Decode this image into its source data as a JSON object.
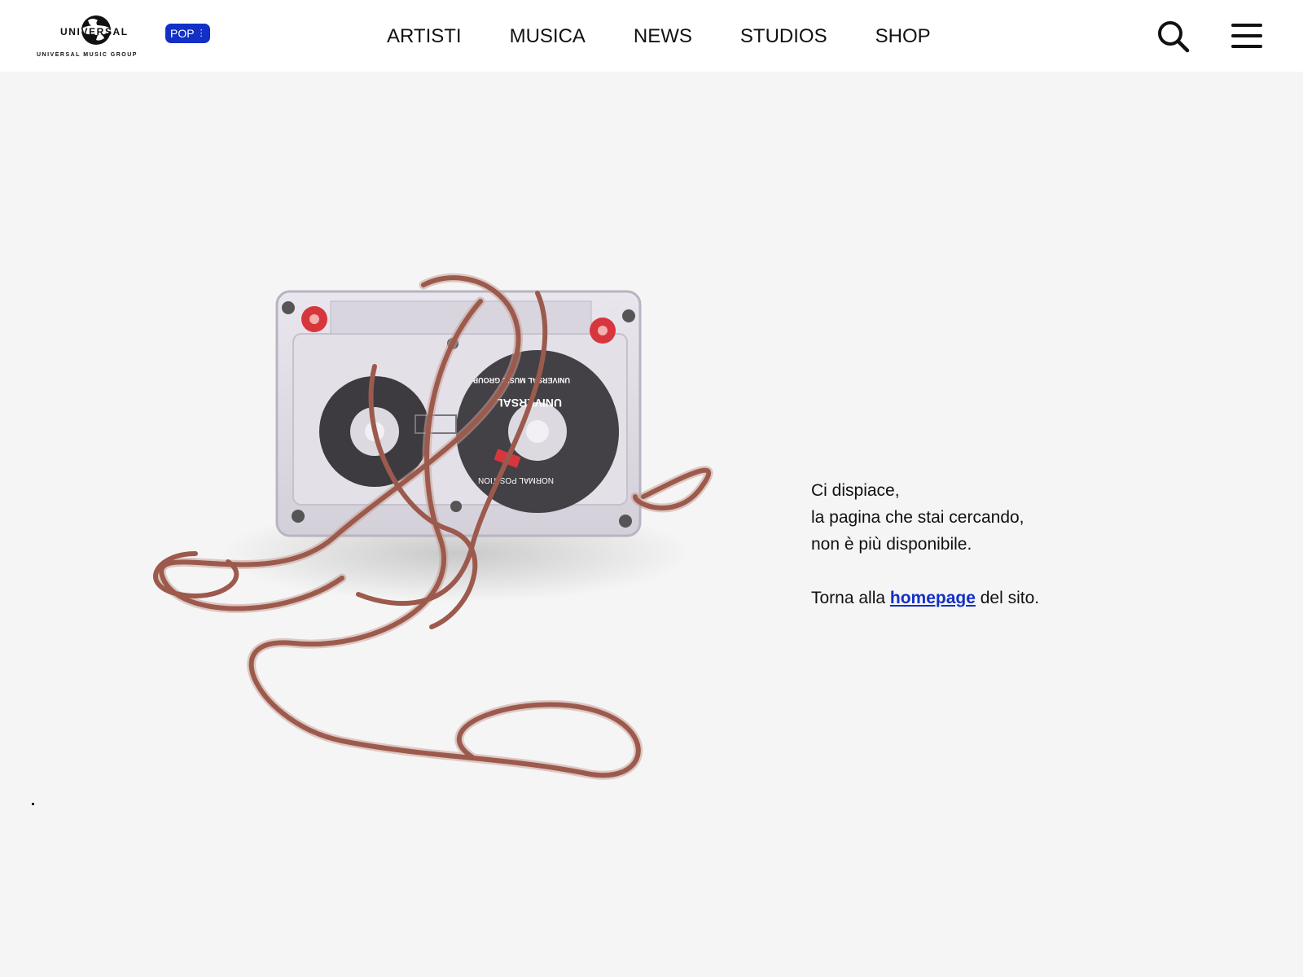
{
  "header": {
    "logo": {
      "wordmark": "UNIVERSAL",
      "subtitle": "UNIVERSAL MUSIC GROUP",
      "icon": "globe-icon"
    },
    "pop_badge": {
      "label": "POP",
      "icon": "vertical-dots-icon",
      "color": "#1230c6"
    },
    "nav": [
      {
        "label": "ARTISTI"
      },
      {
        "label": "MUSICA"
      },
      {
        "label": "NEWS"
      },
      {
        "label": "STUDIOS"
      },
      {
        "label": "SHOP"
      }
    ],
    "search_icon": "search-icon",
    "menu_icon": "hamburger-menu-icon"
  },
  "hero": {
    "image": "tangled-cassette-tape-image",
    "cassette_label": {
      "brand": "UNIVERSAL",
      "group": "UNIVERSAL MUSIC GROUP",
      "position": "NORMAL POSITION"
    }
  },
  "message": {
    "line1": "Ci dispiace,",
    "line2": "la pagina che stai cercando,",
    "line3": "non è più disponibile.",
    "return_prefix": "Torna alla ",
    "return_link": "homepage",
    "return_suffix": " del sito.",
    "link_color": "#1230c6"
  }
}
